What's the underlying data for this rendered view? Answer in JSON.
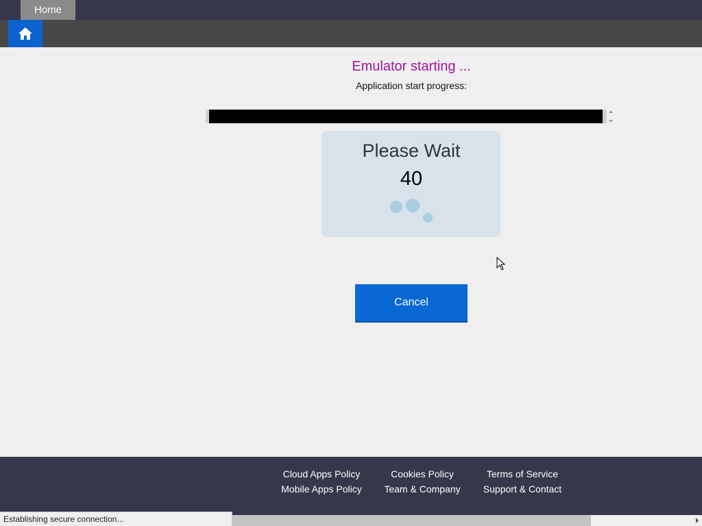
{
  "nav": {
    "home_tab": "Home",
    "home_icon": "home-icon"
  },
  "status": {
    "title": "Emulator starting ...",
    "progress_label": "Application start progress:",
    "progress_value": 0.99
  },
  "wait_panel": {
    "title": "Please Wait",
    "countdown": "40",
    "spinner_icon": "loading-dots-icon"
  },
  "actions": {
    "cancel_label": "Cancel"
  },
  "footer": {
    "links": [
      "Cloud Apps Policy",
      "Cookies Policy",
      "Terms of Service",
      "Mobile Apps Policy",
      "Team & Company",
      "Support & Contact"
    ]
  },
  "browser": {
    "status_text": "Establishing secure connection..."
  },
  "colors": {
    "title_color": "#a0149a",
    "accent_blue": "#0a68d4",
    "nav_bg": "#37374b",
    "panel_bg": "#d7e2ea"
  }
}
